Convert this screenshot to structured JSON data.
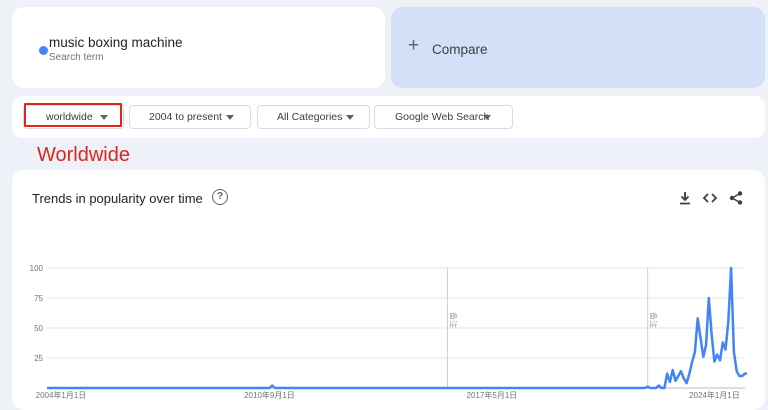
{
  "search_term": {
    "name": "music boxing machine",
    "subtitle": "Search term",
    "color": "#4285f4"
  },
  "compare": {
    "label": "Compare",
    "plus": "+"
  },
  "filters": [
    {
      "label": "worldwide"
    },
    {
      "label": "2004 to present"
    },
    {
      "label": "All Categories"
    },
    {
      "label": "Google Web Search"
    }
  ],
  "annotation": {
    "text": "Worldwide",
    "color": "#e0261c"
  },
  "chart": {
    "title": "Trends in popularity over time",
    "icons": [
      "help-icon",
      "download-icon",
      "embed-icon",
      "share-icon"
    ]
  },
  "chart_data": {
    "type": "line",
    "title": "Trends in popularity over time",
    "ylim": [
      0,
      100
    ],
    "yticks": [
      25,
      50,
      75,
      100
    ],
    "xticks": [
      "2004年1月1日",
      "2010年9月1日",
      "2017年5月1日",
      "2024年1月1日"
    ],
    "grid": true,
    "notes": [
      {
        "date": "2016-01",
        "text": "备注"
      },
      {
        "date": "2022-01",
        "text": "备注"
      }
    ],
    "series": [
      {
        "color": "#4285f4",
        "x": [
          "2004-01",
          "2010-09",
          "2010-10",
          "2010-11",
          "2021-12",
          "2022-01",
          "2022-02",
          "2022-03",
          "2022-04",
          "2022-05",
          "2022-06",
          "2022-07",
          "2022-08",
          "2022-09",
          "2022-10",
          "2022-11",
          "2022-12",
          "2023-01",
          "2023-02",
          "2023-03",
          "2023-04",
          "2023-05",
          "2023-06",
          "2023-07",
          "2023-08",
          "2023-09",
          "2023-10",
          "2023-11",
          "2023-12",
          "2024-01",
          "2024-02",
          "2024-03",
          "2024-04",
          "2024-05",
          "2024-06",
          "2024-07",
          "2024-08",
          "2024-09",
          "2024-10",
          "2024-11",
          "2024-12"
        ],
        "values": [
          0,
          0,
          2,
          0,
          0,
          1,
          0,
          0,
          0,
          2,
          0,
          0,
          12,
          5,
          15,
          6,
          10,
          14,
          8,
          4,
          12,
          22,
          30,
          58,
          42,
          26,
          36,
          75,
          45,
          22,
          28,
          23,
          38,
          32,
          55,
          100,
          30,
          14,
          10,
          10,
          12
        ]
      }
    ]
  }
}
